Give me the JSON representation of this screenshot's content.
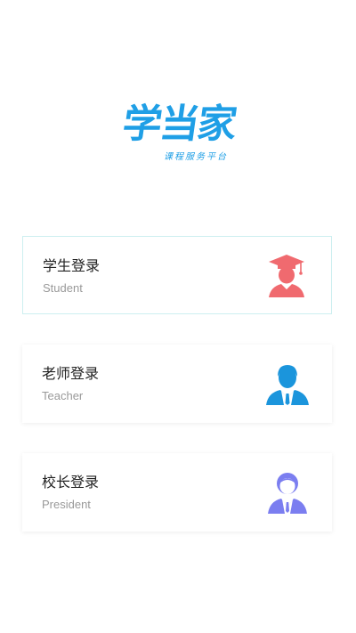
{
  "logo": {
    "title": "学当家",
    "subtitle": "课程服务平台"
  },
  "login_options": [
    {
      "title": "学生登录",
      "subtitle": "Student",
      "icon": "graduate-icon",
      "color": "#f06a6f"
    },
    {
      "title": "老师登录",
      "subtitle": "Teacher",
      "icon": "teacher-icon",
      "color": "#1b95dc"
    },
    {
      "title": "校长登录",
      "subtitle": "President",
      "icon": "president-icon",
      "color": "#7b7ef0"
    }
  ]
}
